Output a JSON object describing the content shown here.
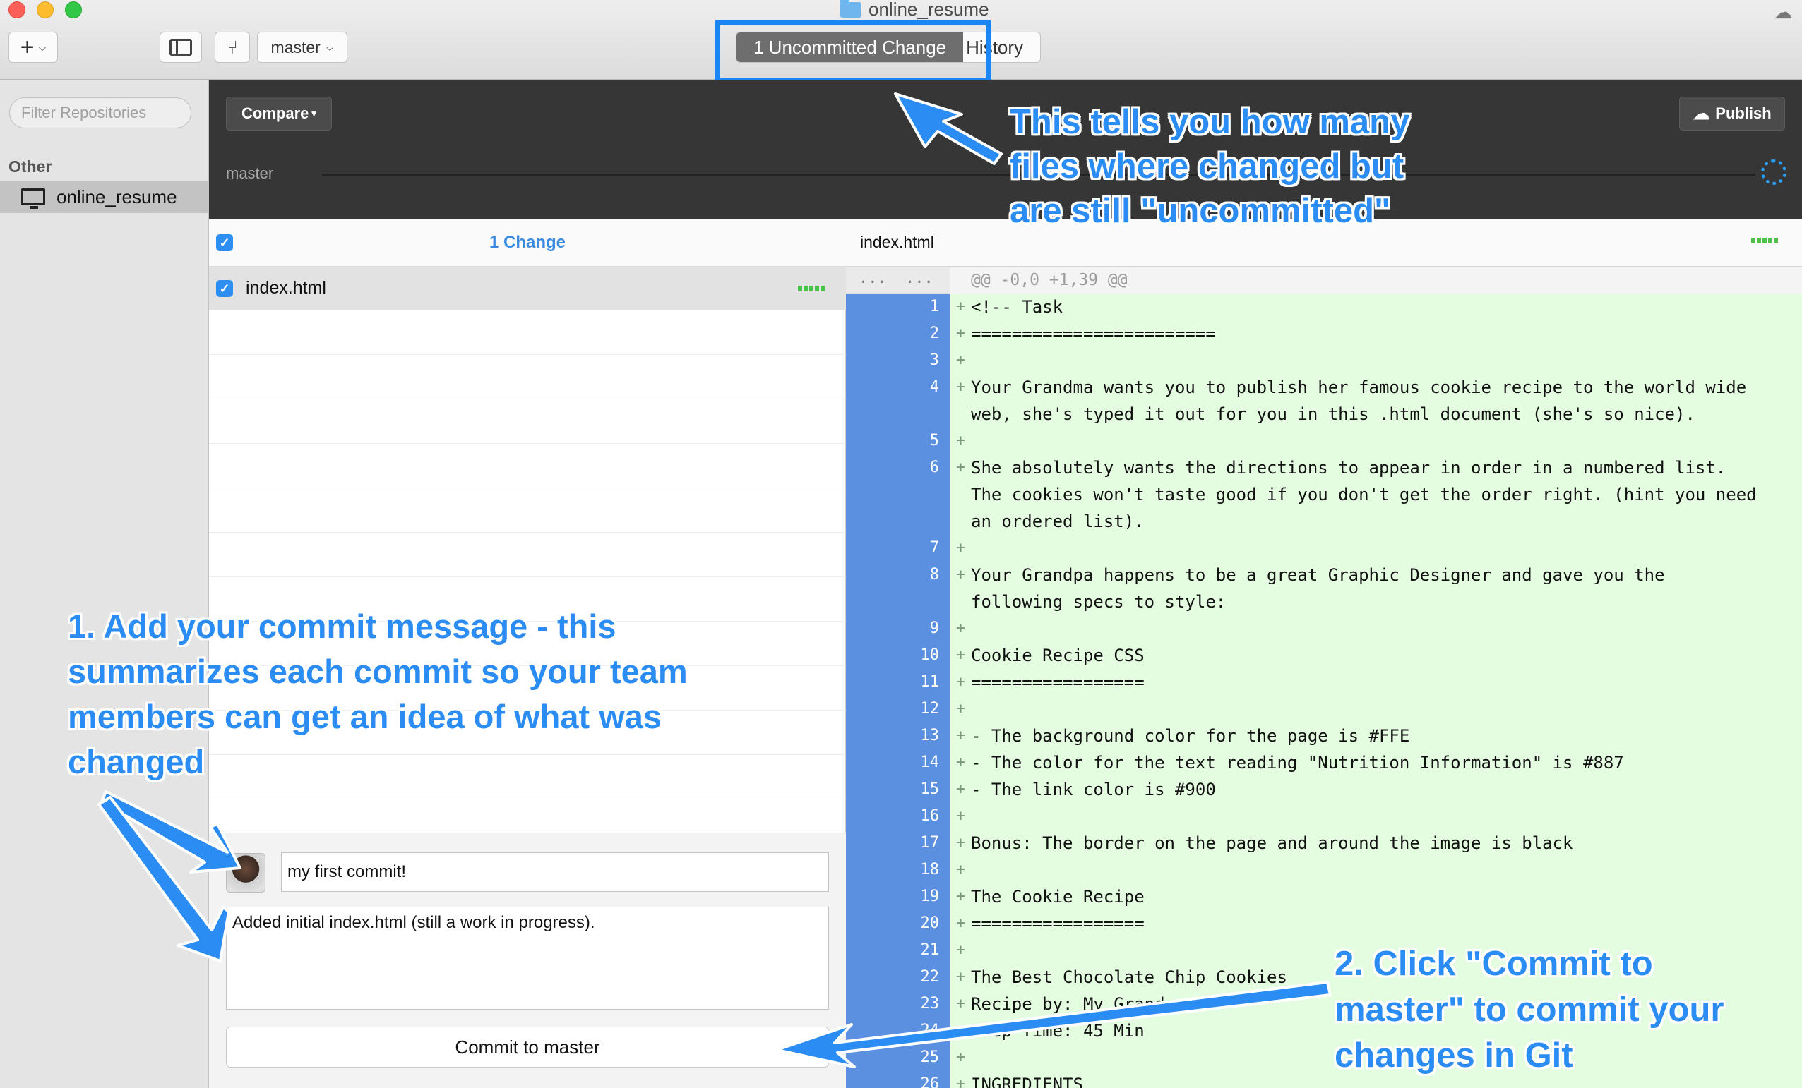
{
  "window": {
    "title": "online_resume",
    "tabs": [
      {
        "label": "1 Uncommitted Change",
        "active": true
      },
      {
        "label": "History",
        "active": false
      }
    ],
    "branch_button": "master",
    "add_button": "+"
  },
  "sidebar": {
    "filter_placeholder": "Filter Repositories",
    "section": "Other",
    "repo": "online_resume"
  },
  "compare_bar": {
    "compare_label": "Compare",
    "publish_label": "Publish",
    "branch": "master"
  },
  "changes": {
    "count_label": "1 Change",
    "file": "index.html"
  },
  "commit": {
    "summary": "my first commit!",
    "description": "Added initial index.html (still a work in progress).",
    "button": "Commit to master"
  },
  "diff": {
    "file": "index.html",
    "hunk": "@@ -0,0 +1,39 @@",
    "hunk_gutter_old": "...",
    "hunk_gutter_new": "...",
    "lines": [
      {
        "n": "1",
        "t": "<!-- Task"
      },
      {
        "n": "2",
        "t": "========================"
      },
      {
        "n": "3",
        "t": ""
      },
      {
        "n": "4",
        "t": "Your Grandma wants you to publish her famous cookie recipe to the world wide\nweb, she's typed it out for you in this .html document (she's so nice)."
      },
      {
        "n": "5",
        "t": ""
      },
      {
        "n": "6",
        "t": "She absolutely wants the directions to appear in order in a numbered list.\nThe cookies won't taste good if you don't get the order right. (hint you need\nan ordered list)."
      },
      {
        "n": "7",
        "t": ""
      },
      {
        "n": "8",
        "t": "Your Grandpa happens to be a great Graphic Designer and gave you the\nfollowing specs to style:"
      },
      {
        "n": "9",
        "t": ""
      },
      {
        "n": "10",
        "t": "Cookie Recipe CSS"
      },
      {
        "n": "11",
        "t": "================="
      },
      {
        "n": "12",
        "t": ""
      },
      {
        "n": "13",
        "t": "- The background color for the page is #FFE"
      },
      {
        "n": "14",
        "t": "- The color for the text reading \"Nutrition Information\" is #887"
      },
      {
        "n": "15",
        "t": "- The link color is #900"
      },
      {
        "n": "16",
        "t": ""
      },
      {
        "n": "17",
        "t": "Bonus: The border on the page and around the image is black"
      },
      {
        "n": "18",
        "t": ""
      },
      {
        "n": "19",
        "t": "The Cookie Recipe"
      },
      {
        "n": "20",
        "t": "================="
      },
      {
        "n": "21",
        "t": ""
      },
      {
        "n": "22",
        "t": "The Best Chocolate Chip Cookies"
      },
      {
        "n": "23",
        "t": "Recipe by: My Grandma"
      },
      {
        "n": "24",
        "t": "Prep Time: 45 Min"
      },
      {
        "n": "25",
        "t": ""
      },
      {
        "n": "26",
        "t": "INGREDIENTS"
      }
    ]
  },
  "annotations": {
    "top": "This tells you how many\nfiles where changed but\nare still \"uncommitted\"",
    "left": "1. Add your commit message - this\nsummarizes each commit so your team\nmembers can get an idea of what was\nchanged",
    "right": "2. Click \"Commit to\nmaster\" to commit your\nchanges in Git"
  },
  "colors": {
    "accent": "#2b8df3",
    "diff_added_bg": "#e4fde0",
    "gutter_bg": "#5b8fe0",
    "dark_bar": "#363636"
  }
}
